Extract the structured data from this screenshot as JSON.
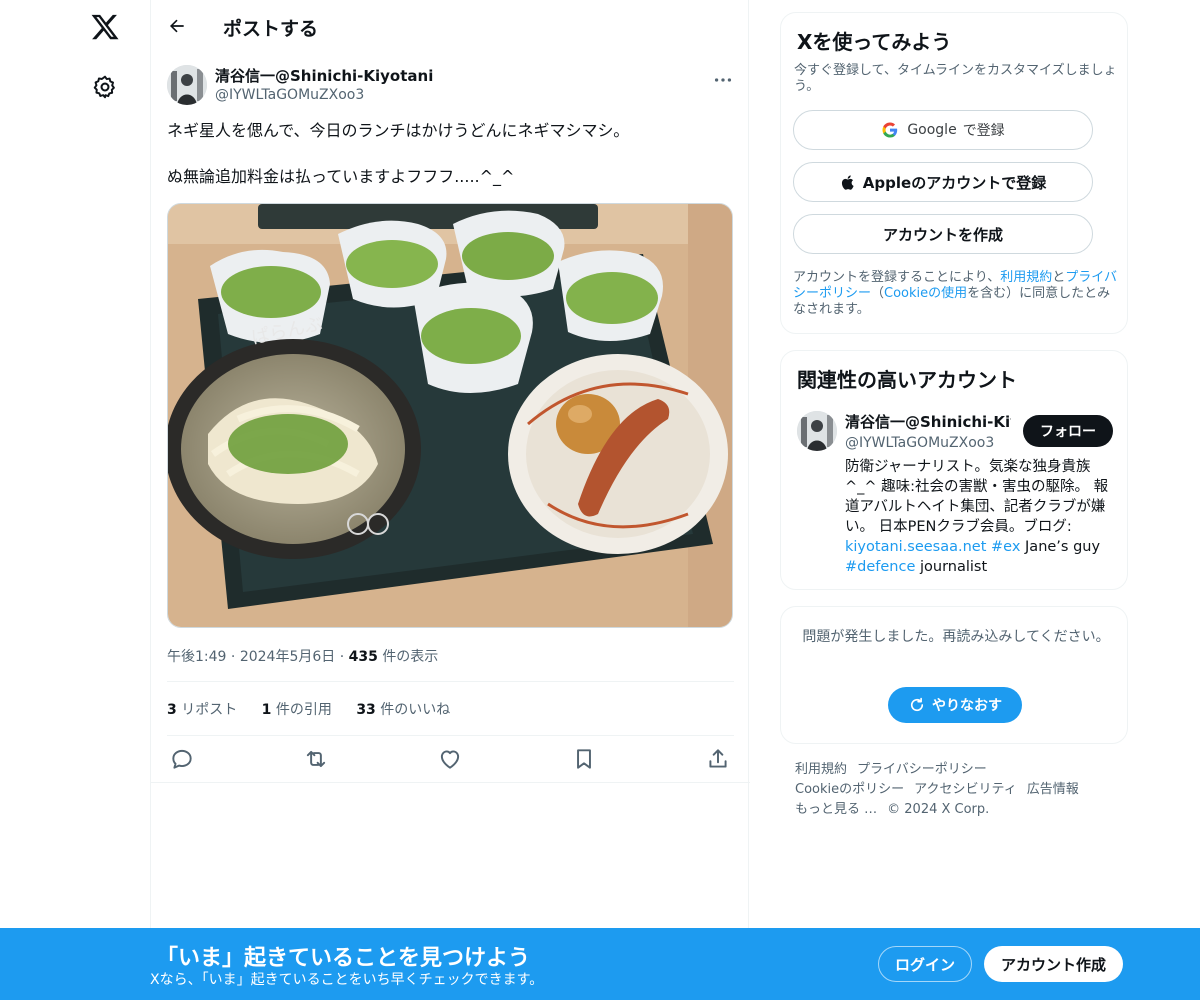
{
  "colors": {
    "accent": "#1d9bf0",
    "text": "#0f1419",
    "muted": "#536471",
    "border": "#eff3f4"
  },
  "nav": {
    "logo_icon": "x-logo-icon",
    "settings_icon": "gear-icon"
  },
  "header": {
    "title": "ポストする",
    "back_icon": "arrow-left-icon"
  },
  "post": {
    "author_name": "清谷信一@Shinichi-Kiyotani",
    "author_handle": "@IYWLTaGOMuZXoo3",
    "text_line1": "ネギ星人を偲んで、今日のランチはかけうどんにネギマシマシ。",
    "text_line2": "ぬ無論追加料金は払っていますよフフフ.....^_^",
    "time": "午後1:49",
    "date": "2024年5月6日",
    "views_count": "435",
    "views_label": "件の表示",
    "reposts_count": "3",
    "reposts_label": "リポスト",
    "quotes_count": "1",
    "quotes_label": "件の引用",
    "likes_count": "33",
    "likes_label": "件のいいね"
  },
  "signup_card": {
    "title": "Xを使ってみよう",
    "subtitle": "今すぐ登録して、タイムラインをカスタマイズしましょう。",
    "google_brand": "Google",
    "google_suffix": "で登録",
    "apple_label": "Appleのアカウントで登録",
    "create_label": "アカウントを作成",
    "legal_1": "アカウントを登録することにより、",
    "legal_terms": "利用規約",
    "legal_2": "と",
    "legal_privacy": "プライバシーポリシー",
    "legal_3": "（",
    "legal_cookie": "Cookieの使用",
    "legal_4": "を含む）に同意したとみなされます。"
  },
  "related_card": {
    "title": "関連性の高いアカウント",
    "name": "清谷信一@Shinichi-Kiyotani",
    "handle": "@IYWLTaGOMuZXoo3",
    "follow_label": "フォロー",
    "bio_text": "防衛ジャーナリスト。気楽な独身貴族 ^_^ 趣味:社会の害獣・害虫の駆除。 報道アバルトヘイト集団、記者クラブが嫌い。 日本PENクラブ会員。ブログ: ",
    "bio_link": "kiyotani.seesaa.net",
    "bio_tag1": "#ex",
    "bio_mid": " Jane’s guy ",
    "bio_tag2": "#defence",
    "bio_end": " journalist"
  },
  "error_card": {
    "message": "問題が発生しました。再読み込みしてください。",
    "retry_label": "やりなおす"
  },
  "footer": {
    "links": [
      "利用規約",
      "プライバシーポリシー",
      "Cookieのポリシー",
      "アクセシビリティ",
      "広告情報",
      "もっと見る …",
      "© 2024 X Corp."
    ]
  },
  "bottom_bar": {
    "title": "「いま」起きていることを見つけよう",
    "subtitle": "Xなら、「いま」起きていることをいち早くチェックできます。",
    "login_label": "ログイン",
    "signup_label": "アカウント作成"
  }
}
